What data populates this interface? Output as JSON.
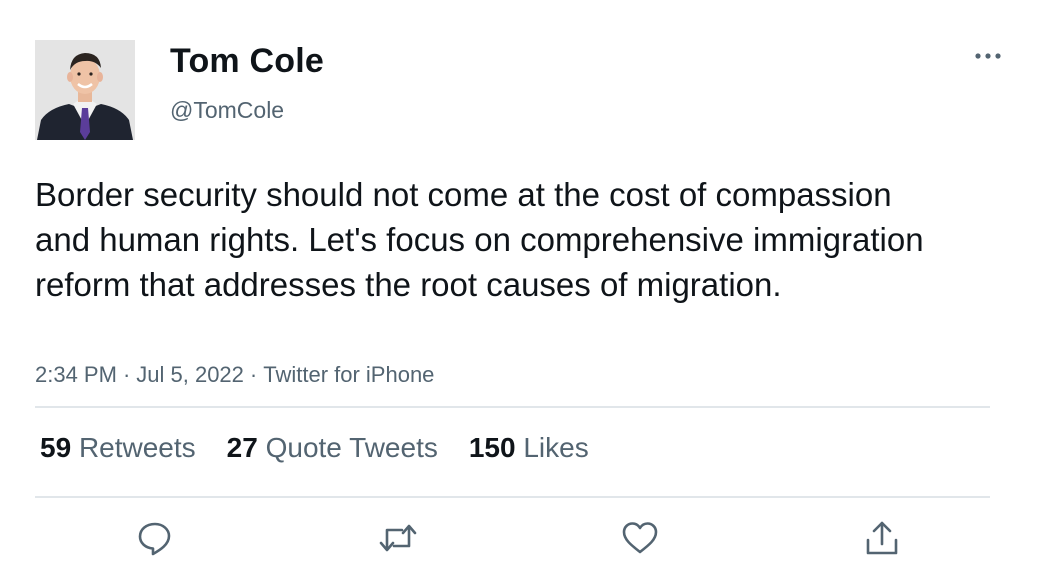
{
  "author": {
    "display_name": "Tom Cole",
    "handle": "@TomCole"
  },
  "tweet": {
    "text": "Border security should not come at the cost of compassion and human rights. Let's focus on comprehensive immigration reform that addresses the root causes of migration.",
    "time": "2:34 PM",
    "date": "Jul 5, 2022",
    "source": "Twitter for iPhone",
    "separator": "·"
  },
  "stats": {
    "retweets": {
      "count": "59",
      "label": "Retweets"
    },
    "quotes": {
      "count": "27",
      "label": "Quote Tweets"
    },
    "likes": {
      "count": "150",
      "label": "Likes"
    }
  },
  "icons": {
    "more": "more-horizontal-icon",
    "reply": "reply-icon",
    "retweet": "retweet-icon",
    "like": "heart-icon",
    "share": "share-icon"
  },
  "colors": {
    "text_primary": "#0f1419",
    "text_secondary": "#536471",
    "divider": "#e1e6ea"
  }
}
